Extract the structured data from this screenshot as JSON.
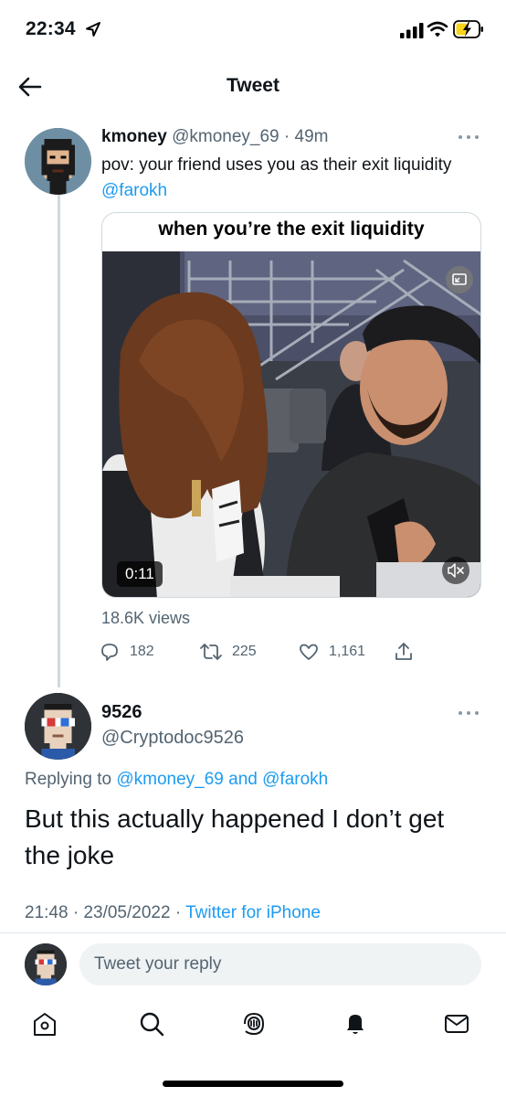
{
  "status_bar": {
    "time": "22:34"
  },
  "nav": {
    "title": "Tweet"
  },
  "tweet": {
    "display_name": "kmoney",
    "handle": "@kmoney_69",
    "separator": "·",
    "age": "49m",
    "text": "pov: your friend uses you as their exit liquidity",
    "mention": "@farokh",
    "media": {
      "caption": "when you’re the exit liquidity",
      "duration": "0:11"
    },
    "views": "18.6K views",
    "stats": {
      "replies": "182",
      "retweets": "225",
      "likes": "1,161"
    }
  },
  "reply": {
    "display_name": "9526",
    "handle": "@Cryptodoc9526",
    "replying_prefix": "Replying to",
    "replying_user1": "@kmoney_69",
    "replying_and": "and",
    "replying_user2": "@farokh",
    "text": "But this actually happened I don’t get the joke",
    "time": "21:48",
    "date": "23/05/2022",
    "separator": "·",
    "source": "Twitter for iPhone"
  },
  "composer": {
    "placeholder": "Tweet your reply"
  },
  "tab_bar": {
    "items": [
      "home-icon",
      "search-icon",
      "spaces-icon",
      "notifications-icon",
      "messages-icon"
    ]
  },
  "colors": {
    "accent": "#1d9bf0",
    "secondary_text": "#536471",
    "primary_text": "#0f1419"
  }
}
